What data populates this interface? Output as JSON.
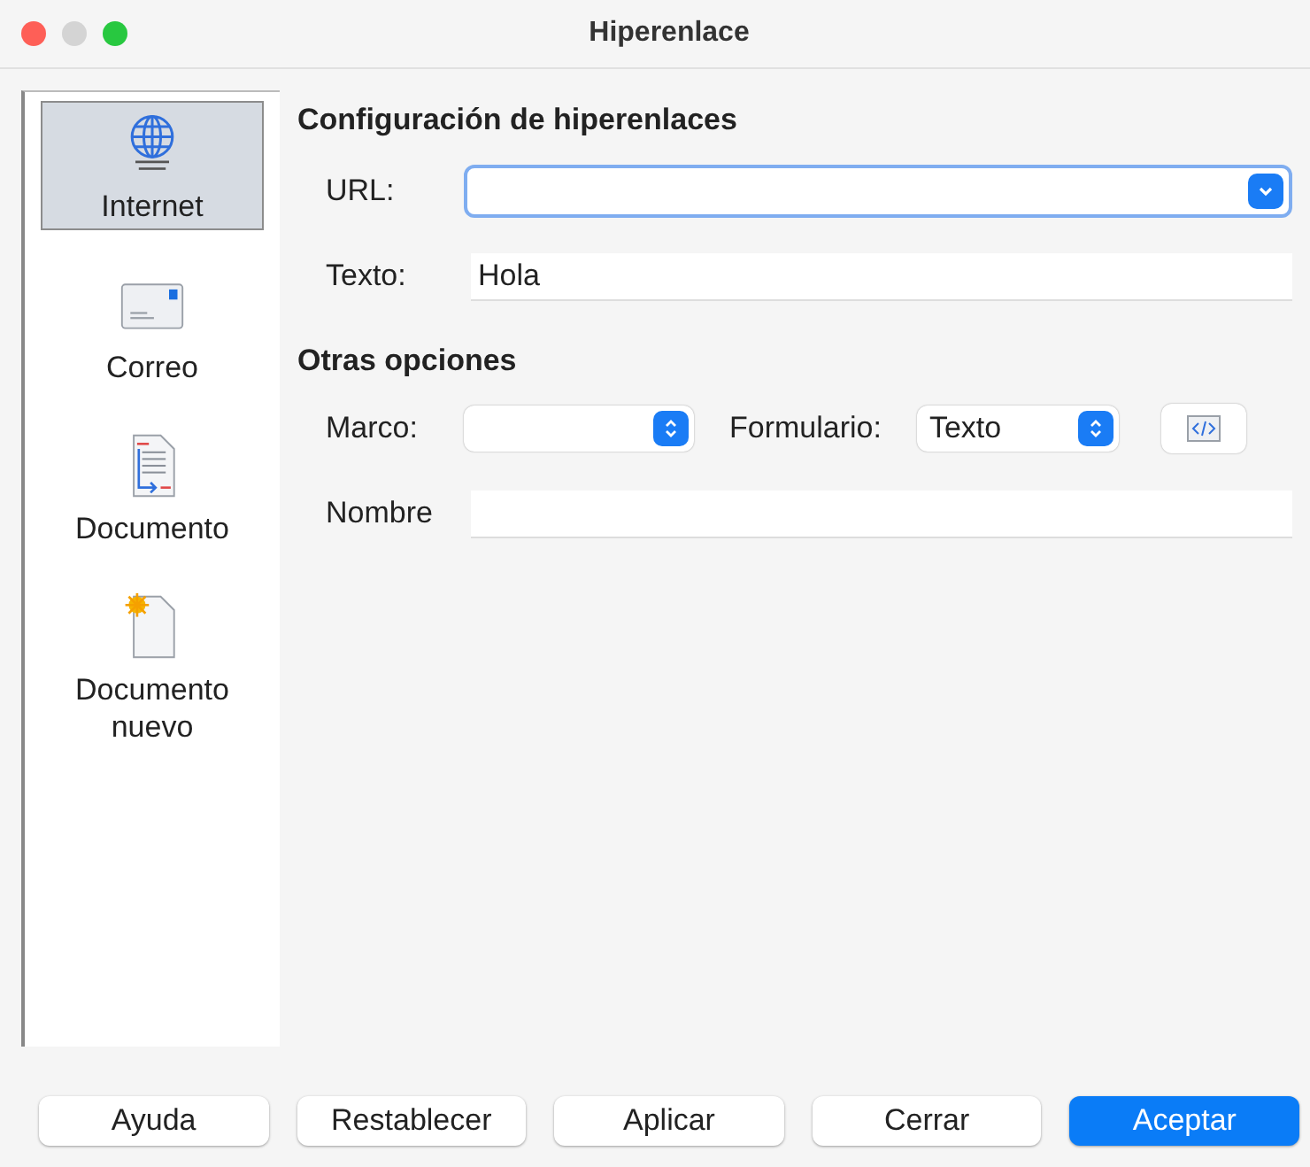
{
  "window": {
    "title": "Hiperenlace"
  },
  "sidebar": {
    "items": [
      {
        "label": "Internet",
        "kind": "globe",
        "selected": true
      },
      {
        "label": "Correo",
        "kind": "mail",
        "selected": false
      },
      {
        "label": "Documento",
        "kind": "document",
        "selected": false
      },
      {
        "label": "Documento nuevo",
        "kind": "new-document",
        "selected": false
      }
    ]
  },
  "hyperlink_settings": {
    "heading": "Configuración de hiperenlaces",
    "url": {
      "label": "URL:",
      "focused": true
    },
    "text": {
      "label": "Texto:",
      "value": "Hola"
    }
  },
  "other_options": {
    "heading": "Otras opciones",
    "frame": {
      "label": "Marco:"
    },
    "form": {
      "label": "Formulario:",
      "value": "Texto"
    },
    "name": {
      "label": "Nombre"
    }
  },
  "buttons": [
    {
      "label": "Ayuda",
      "default": false
    },
    {
      "label": "Restablecer",
      "default": false
    },
    {
      "label": "Aplicar",
      "default": false
    },
    {
      "label": "Cerrar",
      "default": false
    },
    {
      "label": "Aceptar",
      "default": true
    }
  ]
}
